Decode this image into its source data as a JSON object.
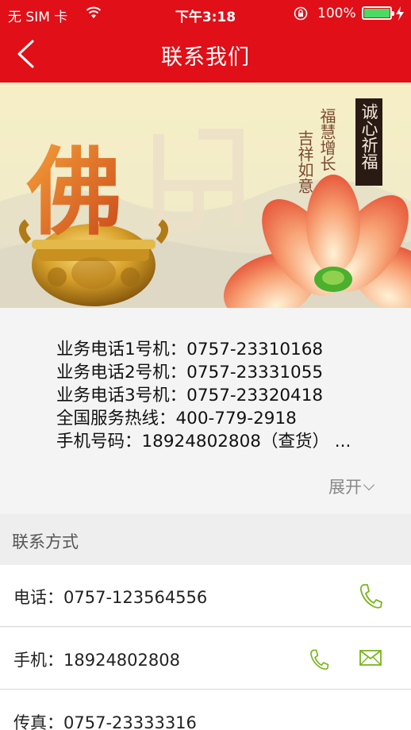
{
  "status_bar": {
    "carrier": "无 SIM 卡",
    "time": "下午3:18",
    "battery_percent": "100%"
  },
  "nav": {
    "title": "联系我们"
  },
  "banner": {
    "big_char": "佛",
    "seal_text": "诚心祈福",
    "calligraphy_1": "福慧增长",
    "calligraphy_2": "吉祥如意"
  },
  "info": {
    "lines": [
      "业务电话1号机：0757-23310168",
      "业务电话2号机：0757-23331055",
      "业务电话3号机：0757-23320418",
      "全国服务热线：400-779-2918",
      "手机号码：18924802808（查货） ..."
    ],
    "expand_label": "展开"
  },
  "contact": {
    "section_title": "联系方式",
    "rows": [
      {
        "text": "电话：0757-123564556"
      },
      {
        "text": "手机：18924802808"
      },
      {
        "text": "传真：0757-23333316"
      }
    ]
  },
  "colors": {
    "nav_red": "#e00f18",
    "icon_green": "#7ab51d"
  }
}
